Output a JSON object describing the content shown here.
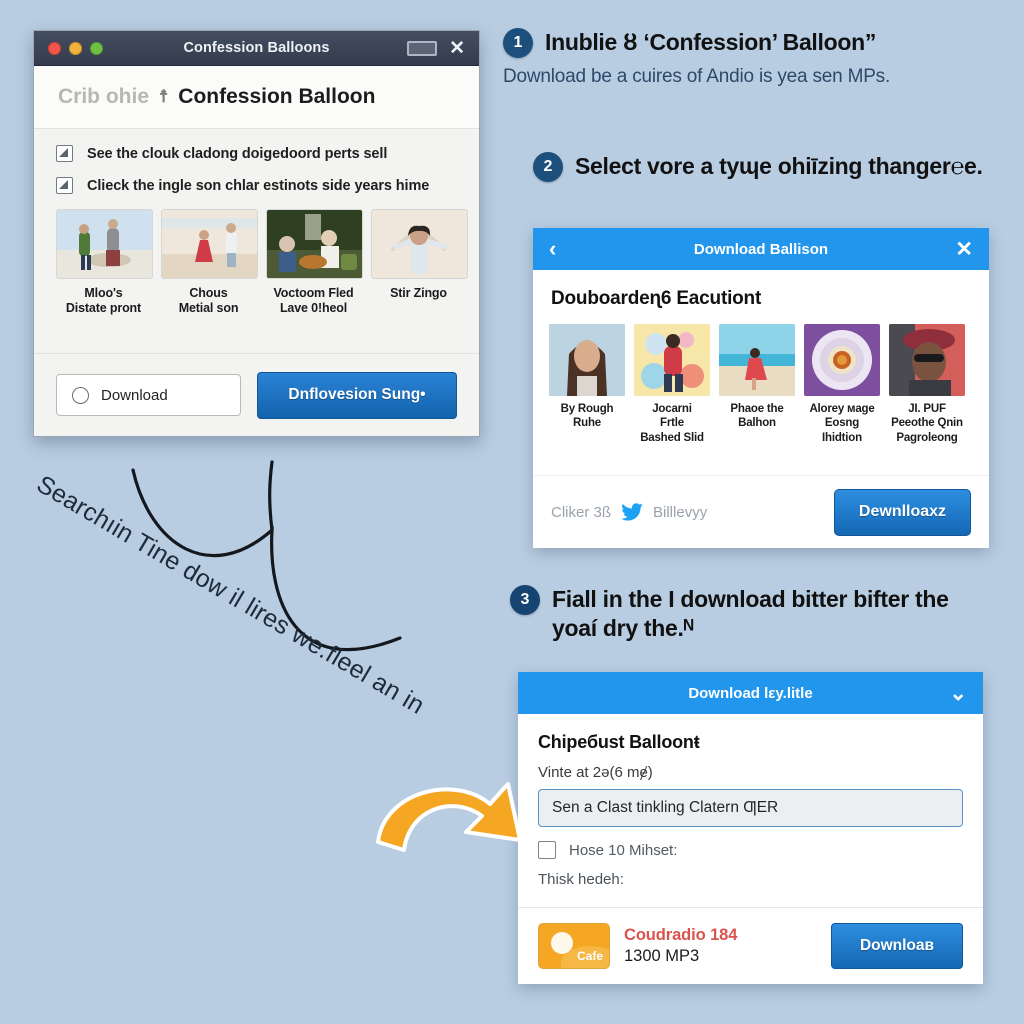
{
  "background_color": "#b9cde2",
  "accent_blue": "#2196ec",
  "badge_color": "#1c4f7c",
  "arrow_color": "#f5a623",
  "window1": {
    "titlebar_caption": "Confession Balloons",
    "minimize_icon": "minimize-icon",
    "close_icon": "close-icon",
    "brand_grey": "Crib ohie",
    "brand_mark": "☨",
    "brand_dark": "Confession Balloon",
    "checks": [
      "See the clouk cladong doigedoord perts sell",
      "Clieck the ingle son chlar estinots side years hime"
    ],
    "thumbs": [
      {
        "caption": "Mloo's\nDistate pront"
      },
      {
        "caption": "Chous\nMetial son"
      },
      {
        "caption": "Voctoom Fled\nLave 0!heol"
      },
      {
        "caption": "Stir Zingo"
      }
    ],
    "toggle_label": "Download",
    "cta_label": "Dnflovesion Sung•"
  },
  "steps": [
    {
      "number": "1",
      "title": "Inublie ȣ ‘Confession’ Balloon”",
      "body": "Download be a cuires of Andio is yea sen MPs."
    },
    {
      "number": "2",
      "title": "Select vore a tyɰe ohiīzing thanger℮e.",
      "body": ""
    },
    {
      "number": "3",
      "title": "Fiall in the I download bitter bifter the yoaí dry the.ᴺ",
      "body": ""
    }
  ],
  "card2": {
    "bar_title": "Download Ballison",
    "back_icon": "chevron-left-icon",
    "close_icon": "close-icon",
    "heading": "Douboardeɳ6 Eacutiont",
    "thumbs": [
      {
        "caption": "By Rough\nRuhe"
      },
      {
        "caption": "Jocarni\nFrtle\nBashed Slid"
      },
      {
        "caption": "Phaoe the\nBalhon"
      },
      {
        "caption": "Alorey ᴍage\nEosng\nIhidtion"
      },
      {
        "caption": "JI. PUF\nPeeothe Qnin\nPagroleong"
      }
    ],
    "footer_text_left": "Cliker 3ß",
    "footer_icon": "twitter-bird-icon",
    "footer_text_right": "Billlevyy",
    "cta_label": "Dewnlloaxz"
  },
  "card3": {
    "bar_title": "Download lεy.litle",
    "collapse_icon": "chevron-down-icon",
    "heading": "Chipeбust Balloonŧ",
    "subtext": "Vinte at 2ә(6 mɇ)",
    "input_value": "Sen a Clast tinkling Clatern ƢER",
    "checkbox_label": "Hose 10 Mihset:",
    "note": "Thisk hedeh:",
    "file_icon": "sun-landscape-icon",
    "file_icon_label": "Cafe",
    "file_title": "Coudradio 184",
    "file_sub": "1300 MP3",
    "cta_label": "Downloaв"
  },
  "annotation": {
    "handwritten_text": "Searchıin Tine dow il lireѕ we.fleel an in",
    "doodle_icon": "curved-line-doodle",
    "arrow_icon": "curved-orange-arrow"
  }
}
